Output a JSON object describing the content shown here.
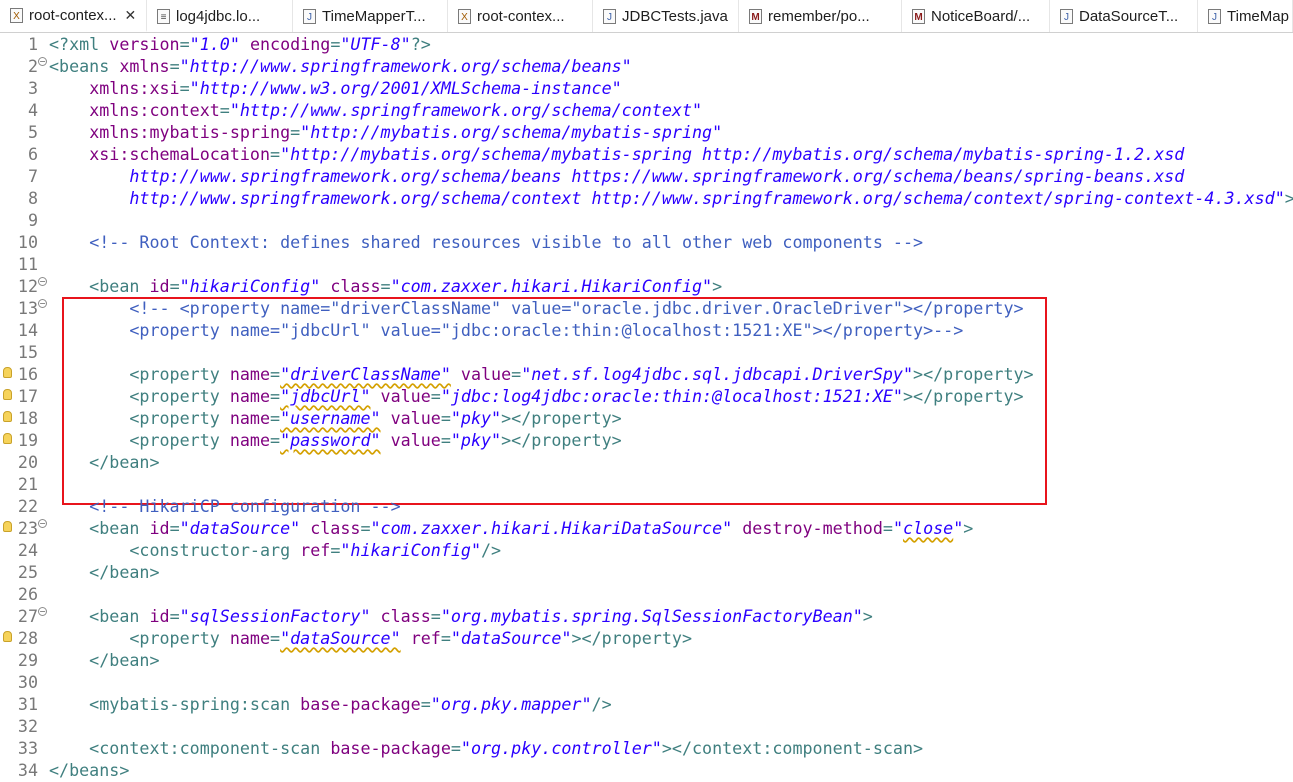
{
  "tabs": [
    {
      "label": "root-contex...",
      "icon": "xml-file-icon",
      "active": true
    },
    {
      "label": "log4jdbc.lo...",
      "icon": "text-file-icon"
    },
    {
      "label": "TimeMapperT...",
      "icon": "java-file-icon"
    },
    {
      "label": "root-contex...",
      "icon": "xml-file-icon"
    },
    {
      "label": "JDBCTests.java",
      "icon": "java-file-icon"
    },
    {
      "label": "remember/po...",
      "icon": "maven-file-icon"
    },
    {
      "label": "NoticeBoard/...",
      "icon": "maven-file-icon"
    },
    {
      "label": "DataSourceT...",
      "icon": "java-file-icon"
    },
    {
      "label": "TimeMap",
      "icon": "java-file-icon"
    }
  ],
  "editor": {
    "highlight_color": "#e8141c",
    "lines": [
      {
        "n": "1",
        "segs": [
          [
            "t",
            "<?xml "
          ],
          [
            "a",
            "version"
          ],
          [
            "t",
            "="
          ],
          [
            "s",
            "\"1.0\""
          ],
          [
            "t",
            " "
          ],
          [
            "a",
            "encoding"
          ],
          [
            "t",
            "="
          ],
          [
            "s",
            "\"UTF-8\""
          ],
          [
            "t",
            "?>"
          ]
        ]
      },
      {
        "n": "2",
        "fold": "⊖",
        "segs": [
          [
            "t",
            "<beans "
          ],
          [
            "a",
            "xmlns"
          ],
          [
            "t",
            "="
          ],
          [
            "s",
            "\"http://www.springframework.org/schema/beans\""
          ]
        ]
      },
      {
        "n": "3",
        "segs": [
          [
            "t",
            "    "
          ],
          [
            "a",
            "xmlns:xsi"
          ],
          [
            "t",
            "="
          ],
          [
            "s",
            "\"http://www.w3.org/2001/XMLSchema-instance\""
          ]
        ]
      },
      {
        "n": "4",
        "segs": [
          [
            "t",
            "    "
          ],
          [
            "a",
            "xmlns:context"
          ],
          [
            "t",
            "="
          ],
          [
            "s",
            "\"http://www.springframework.org/schema/context\""
          ]
        ]
      },
      {
        "n": "5",
        "segs": [
          [
            "t",
            "    "
          ],
          [
            "a",
            "xmlns:mybatis-spring"
          ],
          [
            "t",
            "="
          ],
          [
            "s",
            "\"http://mybatis.org/schema/mybatis-spring\""
          ]
        ]
      },
      {
        "n": "6",
        "segs": [
          [
            "t",
            "    "
          ],
          [
            "a",
            "xsi:schemaLocation"
          ],
          [
            "t",
            "="
          ],
          [
            "s",
            "\"http://mybatis.org/schema/mybatis-spring http://mybatis.org/schema/mybatis-spring-1.2.xsd"
          ]
        ]
      },
      {
        "n": "7",
        "segs": [
          [
            "s",
            "        http://www.springframework.org/schema/beans https://www.springframework.org/schema/beans/spring-beans.xsd"
          ]
        ]
      },
      {
        "n": "8",
        "segs": [
          [
            "s",
            "        http://www.springframework.org/schema/context http://www.springframework.org/schema/context/spring-context-4.3.xsd\""
          ],
          [
            "t",
            ">"
          ]
        ]
      },
      {
        "n": "9",
        "segs": []
      },
      {
        "n": "10",
        "segs": [
          [
            "t",
            "    "
          ],
          [
            "c",
            "<!-- Root Context: defines shared resources visible to all other web components -->"
          ]
        ]
      },
      {
        "n": "11",
        "segs": []
      },
      {
        "n": "12",
        "fold": "⊖",
        "segs": [
          [
            "t",
            "    <bean "
          ],
          [
            "a",
            "id"
          ],
          [
            "t",
            "="
          ],
          [
            "s",
            "\"hikariConfig\""
          ],
          [
            "t",
            " "
          ],
          [
            "a",
            "class"
          ],
          [
            "t",
            "="
          ],
          [
            "s",
            "\"com.zaxxer.hikari.HikariConfig\""
          ],
          [
            "t",
            ">"
          ]
        ]
      },
      {
        "n": "13",
        "fold": "⊖",
        "segs": [
          [
            "t",
            "        "
          ],
          [
            "c",
            "<!-- <property name=\"driverClassName\" value=\"oracle.jdbc.driver.OracleDriver\"></property>"
          ]
        ]
      },
      {
        "n": "14",
        "segs": [
          [
            "t",
            "        "
          ],
          [
            "c",
            "<property name=\"jdbcUrl\" value=\"jdbc:oracle:thin:@localhost:1521:XE\"></property>-->"
          ]
        ]
      },
      {
        "n": "15",
        "segs": []
      },
      {
        "n": "16",
        "warn": true,
        "segs": [
          [
            "t",
            "        <property "
          ],
          [
            "a",
            "name"
          ],
          [
            "t",
            "="
          ],
          [
            "su",
            "\"driverClassName\""
          ],
          [
            "t",
            " "
          ],
          [
            "a",
            "value"
          ],
          [
            "t",
            "="
          ],
          [
            "s",
            "\"net.sf.log4jdbc.sql.jdbcapi.DriverSpy\""
          ],
          [
            "t",
            "></property>"
          ]
        ]
      },
      {
        "n": "17",
        "warn": true,
        "segs": [
          [
            "t",
            "        <property "
          ],
          [
            "a",
            "name"
          ],
          [
            "t",
            "="
          ],
          [
            "su",
            "\"jdbcUrl\""
          ],
          [
            "t",
            " "
          ],
          [
            "a",
            "value"
          ],
          [
            "t",
            "="
          ],
          [
            "s",
            "\"jdbc:log4jdbc:oracle:thin:@localhost:1521:XE\""
          ],
          [
            "t",
            "></property>"
          ]
        ]
      },
      {
        "n": "18",
        "warn": true,
        "segs": [
          [
            "t",
            "        <property "
          ],
          [
            "a",
            "name"
          ],
          [
            "t",
            "="
          ],
          [
            "su",
            "\"username\""
          ],
          [
            "t",
            " "
          ],
          [
            "a",
            "value"
          ],
          [
            "t",
            "="
          ],
          [
            "s",
            "\"pky\""
          ],
          [
            "t",
            "></property>"
          ]
        ]
      },
      {
        "n": "19",
        "warn": true,
        "segs": [
          [
            "t",
            "        <property "
          ],
          [
            "a",
            "name"
          ],
          [
            "t",
            "="
          ],
          [
            "su",
            "\"password\""
          ],
          [
            "t",
            " "
          ],
          [
            "a",
            "value"
          ],
          [
            "t",
            "="
          ],
          [
            "s",
            "\"pky\""
          ],
          [
            "t",
            "></property>"
          ]
        ]
      },
      {
        "n": "20",
        "segs": [
          [
            "t",
            "    </bean>"
          ]
        ]
      },
      {
        "n": "21",
        "segs": []
      },
      {
        "n": "22",
        "segs": [
          [
            "t",
            "    "
          ],
          [
            "c",
            "<!-- HikariCP configuration -->"
          ]
        ]
      },
      {
        "n": "23",
        "warn": true,
        "fold": "⊖",
        "segs": [
          [
            "t",
            "    <bean "
          ],
          [
            "a",
            "id"
          ],
          [
            "t",
            "="
          ],
          [
            "s",
            "\"dataSource\""
          ],
          [
            "t",
            " "
          ],
          [
            "a",
            "class"
          ],
          [
            "t",
            "="
          ],
          [
            "s",
            "\"com.zaxxer.hikari.HikariDataSource\""
          ],
          [
            "t",
            " "
          ],
          [
            "a",
            "destroy-method"
          ],
          [
            "t",
            "="
          ],
          [
            "s",
            "\""
          ],
          [
            "su",
            "close"
          ],
          [
            "s",
            "\""
          ],
          [
            "t",
            ">"
          ]
        ]
      },
      {
        "n": "24",
        "segs": [
          [
            "t",
            "        <constructor-arg "
          ],
          [
            "a",
            "ref"
          ],
          [
            "t",
            "="
          ],
          [
            "s",
            "\"hikariConfig\""
          ],
          [
            "t",
            "/>"
          ]
        ]
      },
      {
        "n": "25",
        "segs": [
          [
            "t",
            "    </bean>"
          ]
        ]
      },
      {
        "n": "26",
        "segs": []
      },
      {
        "n": "27",
        "fold": "⊖",
        "segs": [
          [
            "t",
            "    <bean "
          ],
          [
            "a",
            "id"
          ],
          [
            "t",
            "="
          ],
          [
            "s",
            "\"sqlSessionFactory\""
          ],
          [
            "t",
            " "
          ],
          [
            "a",
            "class"
          ],
          [
            "t",
            "="
          ],
          [
            "s",
            "\"org.mybatis.spring.SqlSessionFactoryBean\""
          ],
          [
            "t",
            ">"
          ]
        ]
      },
      {
        "n": "28",
        "warn": true,
        "segs": [
          [
            "t",
            "        <property "
          ],
          [
            "a",
            "name"
          ],
          [
            "t",
            "="
          ],
          [
            "su",
            "\"dataSource\""
          ],
          [
            "t",
            " "
          ],
          [
            "a",
            "ref"
          ],
          [
            "t",
            "="
          ],
          [
            "s",
            "\"dataSource\""
          ],
          [
            "t",
            "></property>"
          ]
        ]
      },
      {
        "n": "29",
        "segs": [
          [
            "t",
            "    </bean>"
          ]
        ]
      },
      {
        "n": "30",
        "segs": []
      },
      {
        "n": "31",
        "segs": [
          [
            "t",
            "    <mybatis-spring:scan "
          ],
          [
            "a",
            "base-package"
          ],
          [
            "t",
            "="
          ],
          [
            "s",
            "\"org.pky.mapper\""
          ],
          [
            "t",
            "/>"
          ]
        ]
      },
      {
        "n": "32",
        "segs": []
      },
      {
        "n": "33",
        "segs": [
          [
            "t",
            "    <context:component-scan "
          ],
          [
            "a",
            "base-package"
          ],
          [
            "t",
            "="
          ],
          [
            "s",
            "\"org.pky.controller\""
          ],
          [
            "t",
            "></context:component-scan>"
          ]
        ]
      },
      {
        "n": "34",
        "segs": [
          [
            "t",
            "</beans>"
          ]
        ]
      }
    ]
  }
}
